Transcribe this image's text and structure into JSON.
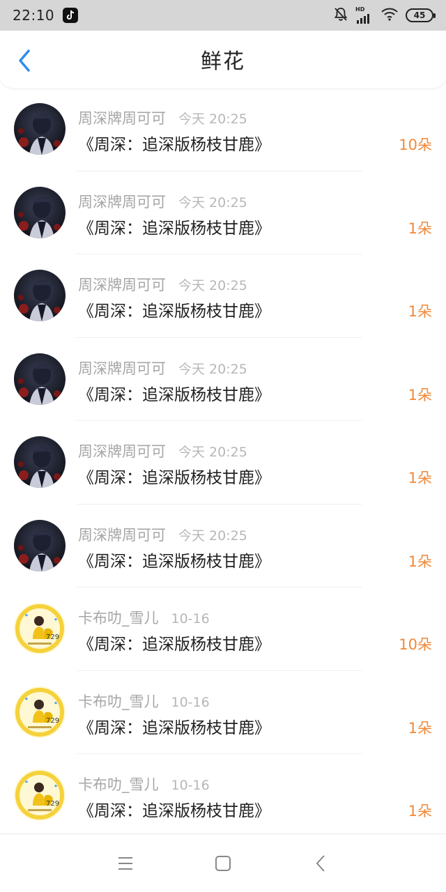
{
  "status_bar": {
    "time": "22:10",
    "battery": "45",
    "network": "HD"
  },
  "header": {
    "title": "鲜花"
  },
  "rows": [
    {
      "user": "周深牌周可可",
      "time": "今天 20:25",
      "title": "《周深：追深版杨枝甘鹿》",
      "count": "10朵",
      "avatar": "dark"
    },
    {
      "user": "周深牌周可可",
      "time": "今天 20:25",
      "title": "《周深：追深版杨枝甘鹿》",
      "count": "1朵",
      "avatar": "dark"
    },
    {
      "user": "周深牌周可可",
      "time": "今天 20:25",
      "title": "《周深：追深版杨枝甘鹿》",
      "count": "1朵",
      "avatar": "dark"
    },
    {
      "user": "周深牌周可可",
      "time": "今天 20:25",
      "title": "《周深：追深版杨枝甘鹿》",
      "count": "1朵",
      "avatar": "dark"
    },
    {
      "user": "周深牌周可可",
      "time": "今天 20:25",
      "title": "《周深：追深版杨枝甘鹿》",
      "count": "1朵",
      "avatar": "dark"
    },
    {
      "user": "周深牌周可可",
      "time": "今天 20:25",
      "title": "《周深：追深版杨枝甘鹿》",
      "count": "1朵",
      "avatar": "dark"
    },
    {
      "user": "卡布叻_雪儿",
      "time": "10-16",
      "title": "《周深：追深版杨枝甘鹿》",
      "count": "10朵",
      "avatar": "yellow"
    },
    {
      "user": "卡布叻_雪儿",
      "time": "10-16",
      "title": "《周深：追深版杨枝甘鹿》",
      "count": "1朵",
      "avatar": "yellow"
    },
    {
      "user": "卡布叻_雪儿",
      "time": "10-16",
      "title": "《周深：追深版杨枝甘鹿》",
      "count": "1朵",
      "avatar": "yellow"
    }
  ],
  "colors": {
    "accent": "#2f8cf0",
    "count": "#f0893a"
  },
  "nav": [
    "menu-icon",
    "home-icon",
    "back-icon"
  ]
}
